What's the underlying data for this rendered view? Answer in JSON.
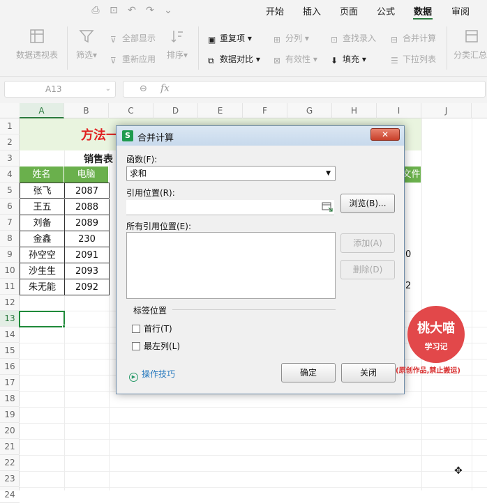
{
  "menu": {
    "items": [
      "开始",
      "插入",
      "页面",
      "公式",
      "数据",
      "审阅"
    ],
    "active": "数据"
  },
  "ribbon": {
    "pivot": "数据透视表",
    "filter": "筛选",
    "show_all": "全部显示",
    "reapply": "重新应用",
    "sort": "排序",
    "duplicates": "重复项",
    "compare": "数据对比",
    "split": "分列",
    "validity": "有效性",
    "lookup": "查找录入",
    "fill": "填充",
    "consolidate": "合并计算",
    "dropdown": "下拉列表",
    "subtotal": "分类汇总"
  },
  "formula_bar": {
    "name_box": "A13",
    "fx": "fx"
  },
  "columns": [
    "A",
    "B",
    "C",
    "D",
    "E",
    "F",
    "G",
    "H",
    "I",
    "J"
  ],
  "rows": [
    "1",
    "2",
    "3",
    "4",
    "5",
    "6",
    "7",
    "8",
    "9",
    "10",
    "11",
    "12",
    "13",
    "14",
    "15",
    "16",
    "17",
    "18",
    "19",
    "20",
    "21",
    "22",
    "23",
    "24"
  ],
  "sheet": {
    "title": "方法一",
    "subtitle": "销售表",
    "headers": [
      "姓名",
      "电脑"
    ],
    "header_right": "文件",
    "names": [
      "张飞",
      "王五",
      "刘备",
      "金鑫",
      "孙空空",
      "沙生生",
      "朱无能"
    ],
    "values": [
      "2087",
      "2088",
      "2089",
      "230",
      "2091",
      "2093",
      "2092"
    ],
    "right_frag_9": "0",
    "right_frag_11": "2"
  },
  "dialog": {
    "title": "合并计算",
    "close": "✕",
    "function_label": "函数(F):",
    "function_value": "求和",
    "ref_label": "引用位置(R):",
    "browse": "浏览(B)...",
    "all_refs_label": "所有引用位置(E):",
    "add": "添加(A)",
    "delete": "删除(D)",
    "label_position": "标签位置",
    "first_row": "首行(T)",
    "left_column": "最左列(L)",
    "tips": "操作技巧",
    "ok": "确定",
    "cancel": "关闭"
  },
  "watermark": {
    "line1": "桃大喵",
    "line2": "学习记",
    "note": "(原创作品,禁止搬运)"
  },
  "colors": {
    "accent_green": "#2a7a3e",
    "header_green": "#6ab04c",
    "title_red": "#e02020",
    "badge_red": "#e2484a"
  }
}
